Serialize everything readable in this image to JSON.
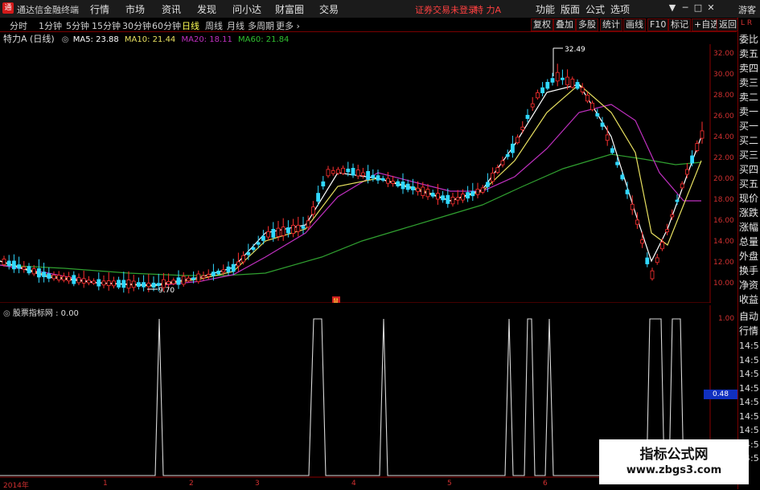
{
  "app": {
    "title": "通达信金融终端",
    "logo": "通"
  },
  "menu": [
    "行情",
    "市场",
    "资讯",
    "发现",
    "问小达",
    "财富圈",
    "交易"
  ],
  "status": {
    "login": "证券交易未登录",
    "stock": "特 力A"
  },
  "right_menu": [
    "功能",
    "版面",
    "公式",
    "选项"
  ],
  "window_controls": [
    "▼",
    "─",
    "□",
    "✕"
  ],
  "guest": "游客",
  "periods": [
    "分时",
    "1分钟",
    "5分钟",
    "15分钟",
    "30分钟",
    "60分钟",
    "日线",
    "周线",
    "月线",
    "多周期",
    "更多 ›"
  ],
  "active_period": "日线",
  "right_buttons": [
    "复权",
    "叠加",
    "多股",
    "统计",
    "画线",
    "F10",
    "标记",
    "+自选",
    "返回"
  ],
  "info": {
    "stock": "特力A (日线)",
    "ma5": "MA5: 23.88",
    "ma10": "MA10: 21.44",
    "ma20": "MA20: 18.11",
    "ma60": "MA60: 21.84"
  },
  "sub_info": "股票指标网 : 0.00",
  "price_axis": [
    "32.00",
    "30.00",
    "28.00",
    "26.00",
    "24.00",
    "22.00",
    "20.00",
    "18.00",
    "16.00",
    "14.00",
    "12.00",
    "10.00"
  ],
  "annotations": {
    "high": "32.49",
    "low": "9.70",
    "marker": "鼠"
  },
  "sub_axis": [
    "1.00",
    "14:5",
    "14:5",
    "14:5",
    "14:5",
    "14:5",
    "14:5",
    "14:5",
    "14:5",
    "14:5"
  ],
  "sub_current": "0.48",
  "x_axis": [
    "2014年",
    "1",
    "2",
    "3",
    "4",
    "5",
    "6"
  ],
  "side_panel": [
    "委比",
    "卖五",
    "卖四",
    "卖三",
    "卖二",
    "卖一",
    "买一",
    "买二",
    "买三",
    "买四",
    "买五",
    "现价",
    "涨跌",
    "涨幅",
    "总量",
    "外盘",
    "换手",
    "净资",
    "收益"
  ],
  "side_top": "L R",
  "side_lower": [
    "自动",
    "行情"
  ],
  "watermark": {
    "title": "指标公式网",
    "url": "www.zbgs3.com"
  },
  "colors": {
    "up": "#ff3030",
    "down": "#30d8ff",
    "ma5": "#ffffff",
    "ma10": "#e8e060",
    "ma20": "#c030c0",
    "ma60": "#30a030",
    "axis": "#c02020"
  }
}
